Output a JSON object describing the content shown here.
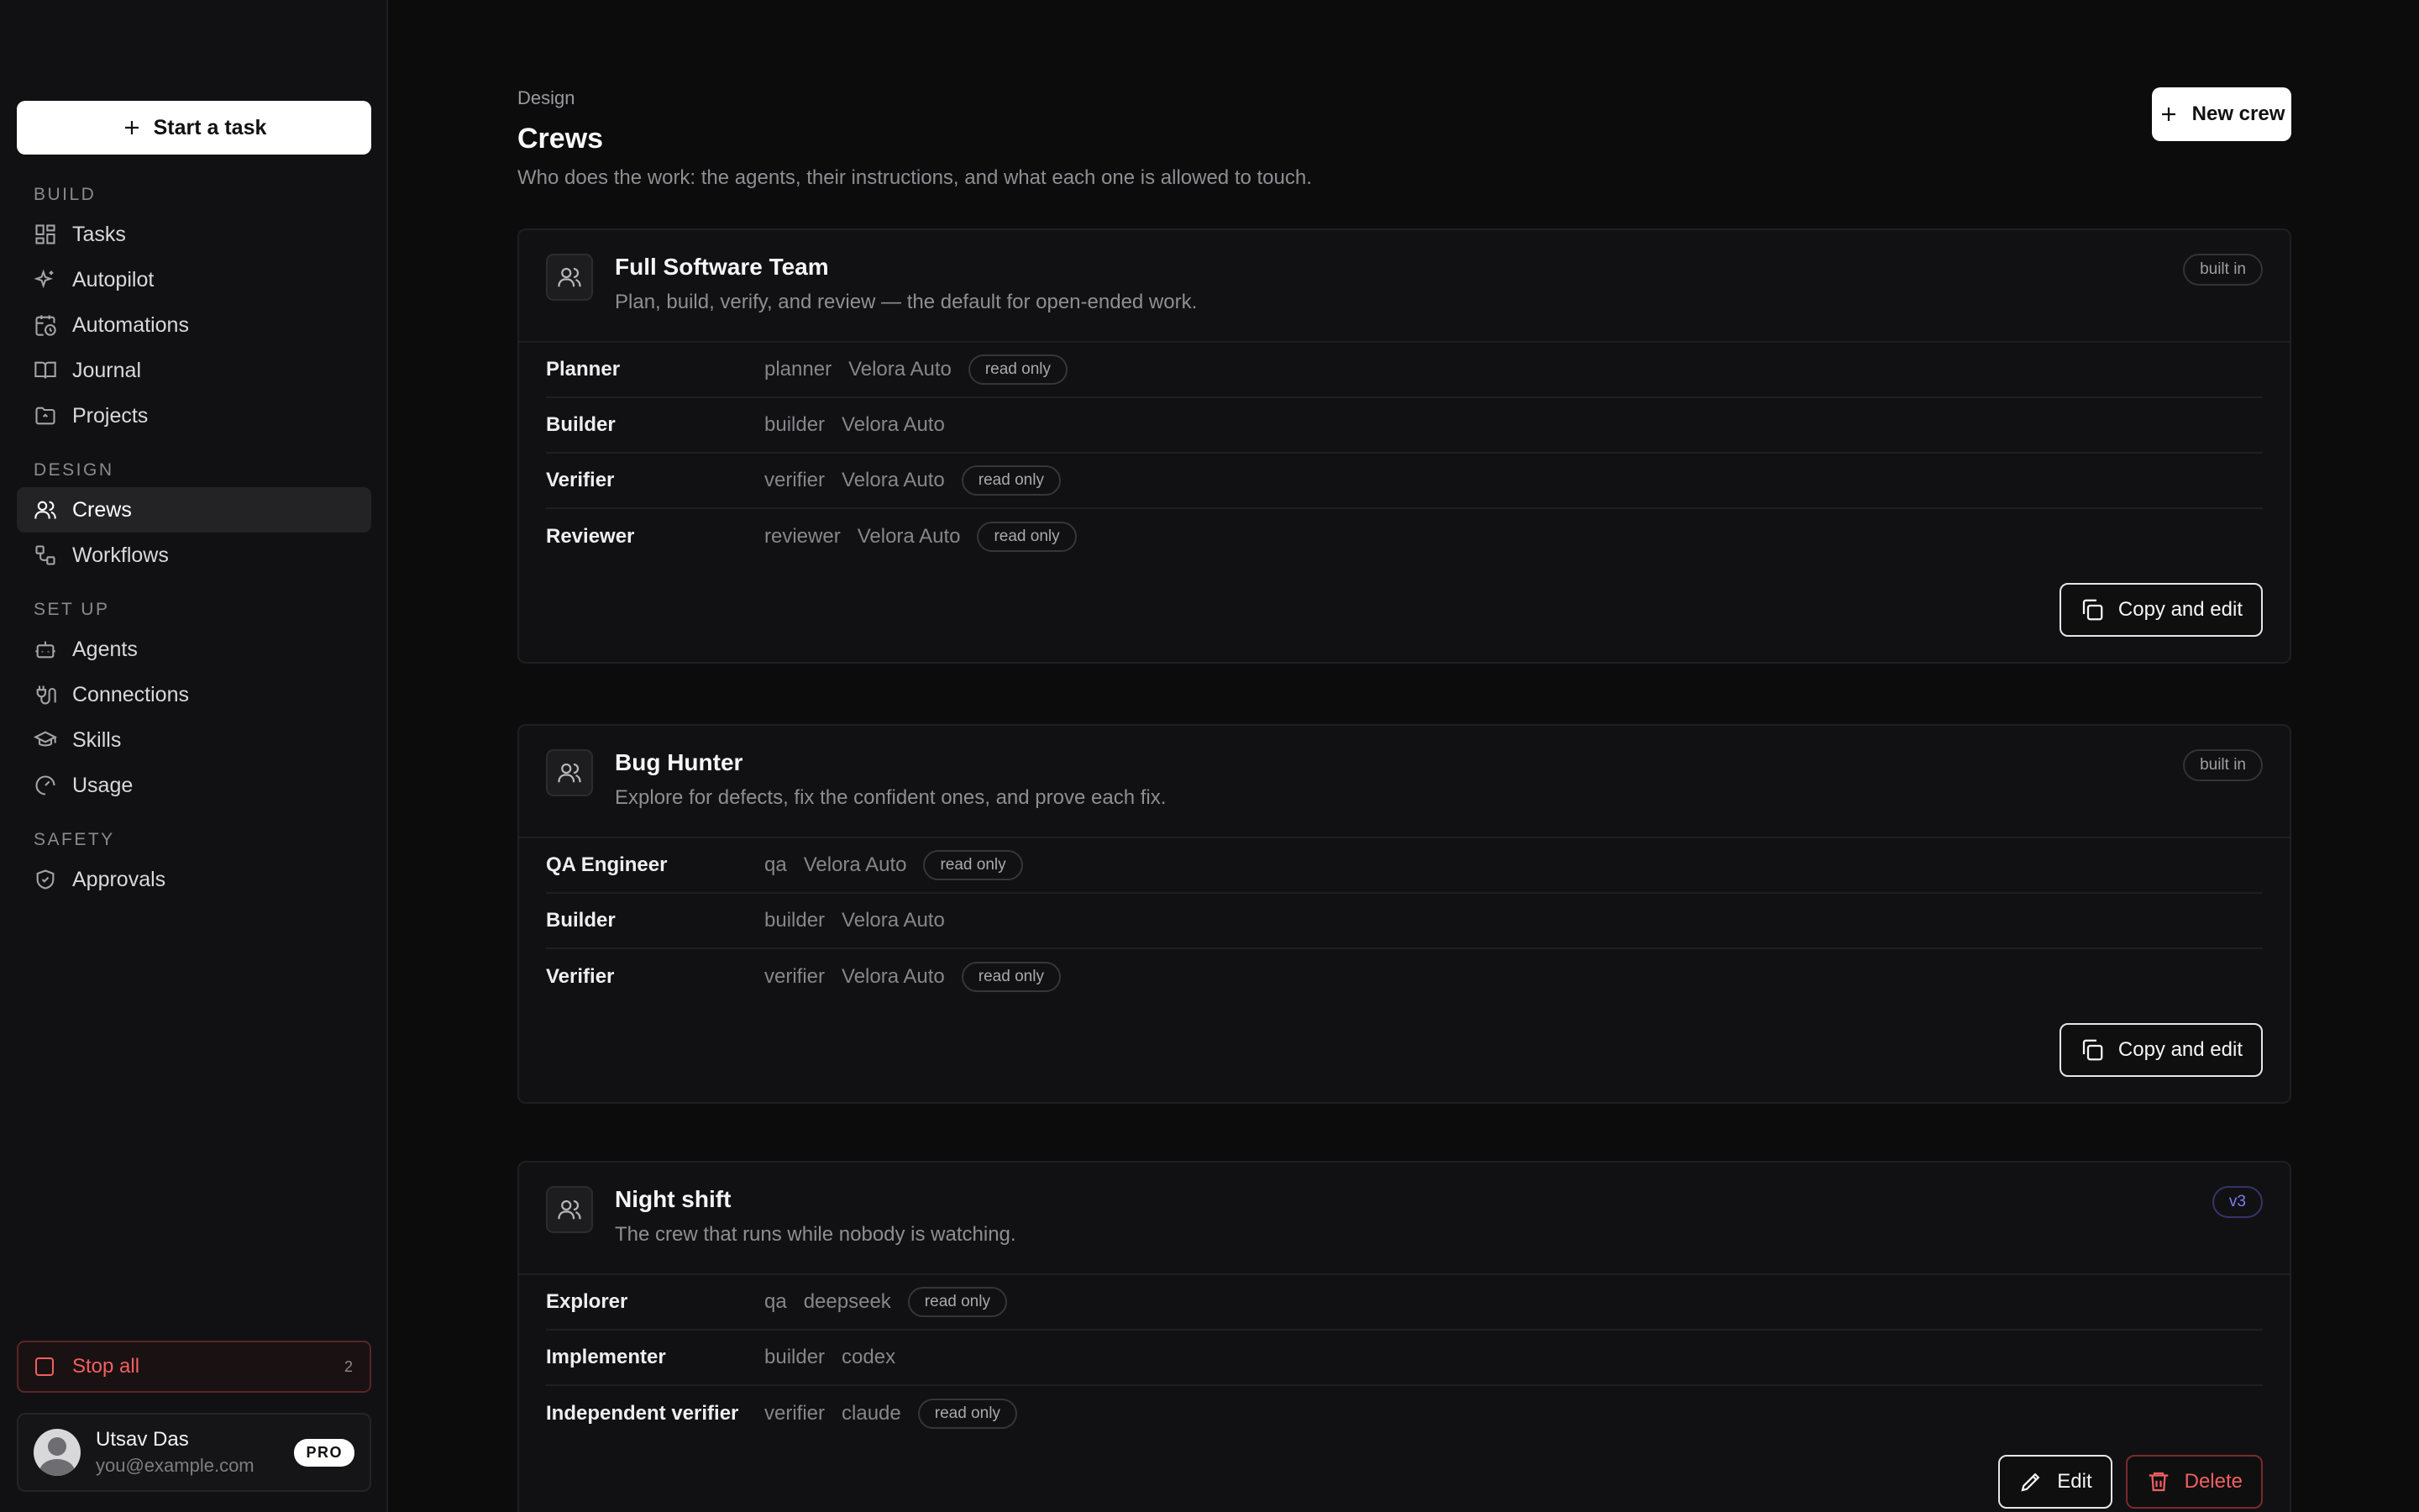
{
  "sidebar": {
    "start_task_label": "Start a task",
    "sections": [
      {
        "title": "BUILD",
        "items": [
          {
            "label": "Tasks",
            "icon": "grid-icon"
          },
          {
            "label": "Autopilot",
            "icon": "sparkle-icon"
          },
          {
            "label": "Automations",
            "icon": "calendar-clock-icon"
          },
          {
            "label": "Journal",
            "icon": "book-icon"
          },
          {
            "label": "Projects",
            "icon": "folder-icon"
          }
        ]
      },
      {
        "title": "DESIGN",
        "items": [
          {
            "label": "Crews",
            "icon": "users-icon",
            "active": true
          },
          {
            "label": "Workflows",
            "icon": "workflow-icon"
          }
        ]
      },
      {
        "title": "SET UP",
        "items": [
          {
            "label": "Agents",
            "icon": "bot-icon"
          },
          {
            "label": "Connections",
            "icon": "plug-icon"
          },
          {
            "label": "Skills",
            "icon": "graduation-cap-icon"
          },
          {
            "label": "Usage",
            "icon": "gauge-icon"
          }
        ]
      },
      {
        "title": "SAFETY",
        "items": [
          {
            "label": "Approvals",
            "icon": "shield-check-icon"
          }
        ]
      }
    ],
    "stop_all": {
      "label": "Stop all",
      "count": "2"
    },
    "user": {
      "name": "Utsav Das",
      "email": "you@example.com",
      "plan": "PRO"
    }
  },
  "header": {
    "breadcrumb": "Design",
    "title": "Crews",
    "subtitle": "Who does the work: the agents, their instructions, and what each one is allowed to touch.",
    "new_crew_label": "New crew"
  },
  "crews": [
    {
      "name": "Full Software Team",
      "description": "Plan, build, verify, and review — the default for open-ended work.",
      "tag": "built in",
      "roles": [
        {
          "name": "Planner",
          "key": "planner",
          "model": "Velora Auto",
          "badge": "read only"
        },
        {
          "name": "Builder",
          "key": "builder",
          "model": "Velora Auto",
          "badge": ""
        },
        {
          "name": "Verifier",
          "key": "verifier",
          "model": "Velora Auto",
          "badge": "read only"
        },
        {
          "name": "Reviewer",
          "key": "reviewer",
          "model": "Velora Auto",
          "badge": "read only"
        }
      ],
      "action_label": "Copy and edit"
    },
    {
      "name": "Bug Hunter",
      "description": "Explore for defects, fix the confident ones, and prove each fix.",
      "tag": "built in",
      "roles": [
        {
          "name": "QA Engineer",
          "key": "qa",
          "model": "Velora Auto",
          "badge": "read only"
        },
        {
          "name": "Builder",
          "key": "builder",
          "model": "Velora Auto",
          "badge": ""
        },
        {
          "name": "Verifier",
          "key": "verifier",
          "model": "Velora Auto",
          "badge": "read only"
        }
      ],
      "action_label": "Copy and edit"
    },
    {
      "name": "Night shift",
      "description": "The crew that runs while nobody is watching.",
      "tag": "v3",
      "roles": [
        {
          "name": "Explorer",
          "key": "qa",
          "model": "deepseek",
          "badge": "read only"
        },
        {
          "name": "Implementer",
          "key": "builder",
          "model": "codex",
          "badge": ""
        },
        {
          "name": "Independent verifier",
          "key": "verifier",
          "model": "claude",
          "badge": "read only"
        }
      ],
      "edit_label": "Edit",
      "delete_label": "Delete"
    }
  ],
  "colors": {
    "danger": "#f0605f",
    "version_accent": "#7e7cf0",
    "background": "#0c0c0d"
  }
}
